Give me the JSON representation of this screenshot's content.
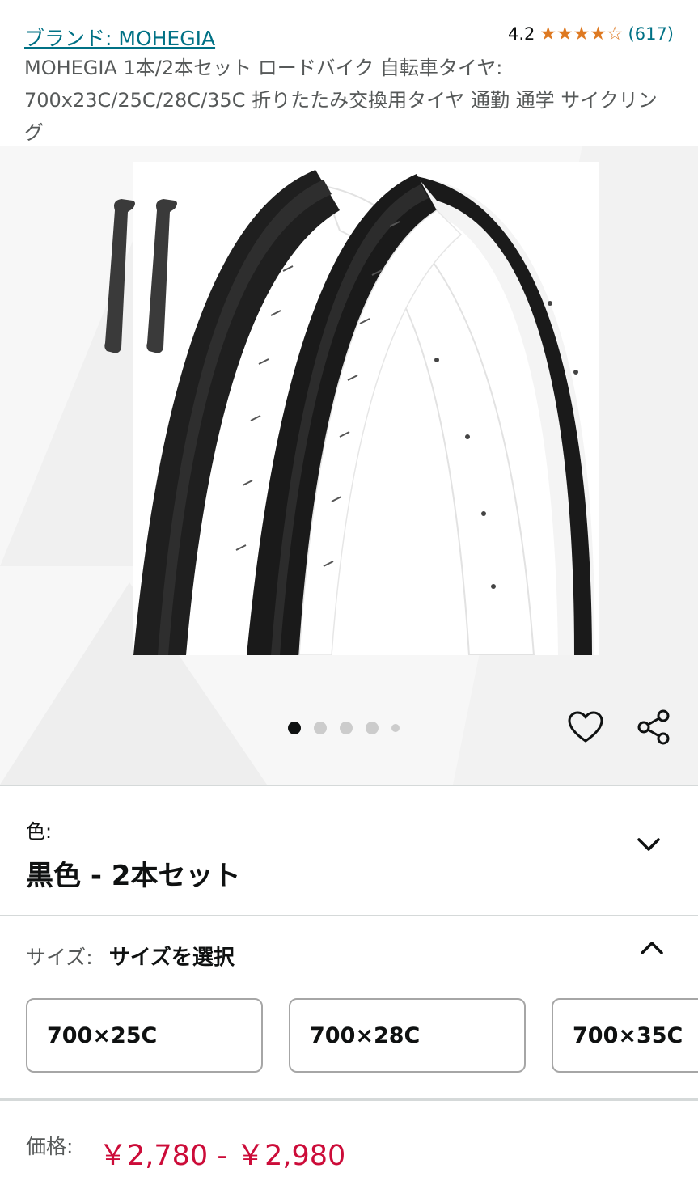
{
  "header": {
    "brand_link": "ブランド: MOHEGIA",
    "rating_value": "4.2",
    "rating_stars": 4.2,
    "rating_count": "(617)",
    "title": "MOHEGIA 1本/2本セット ロードバイク 自転車タイヤ: 700x23C/25C/28C/35C 折りたたみ交換用タイヤ 通勤 通学 サイクリング"
  },
  "carousel": {
    "total_images": 5,
    "active_index": 0
  },
  "color": {
    "label": "色:",
    "value": "黒色 - 2本セット"
  },
  "size": {
    "label": "サイズ:",
    "value": "サイズを選択",
    "options": [
      "700×25C",
      "700×28C",
      "700×35C"
    ]
  },
  "price": {
    "label": "価格:",
    "value": "￥2,780 - ￥2,980"
  },
  "colors": {
    "link": "#007185",
    "star": "#de7921",
    "price": "#cc0c39"
  }
}
